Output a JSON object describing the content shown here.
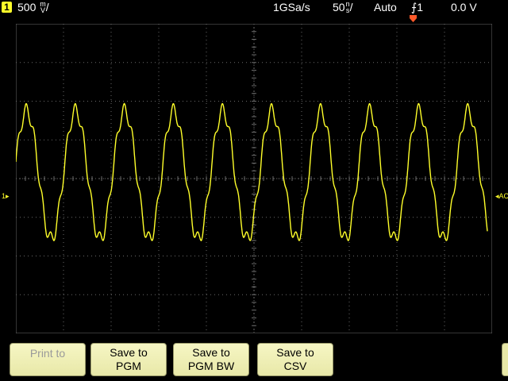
{
  "status": {
    "channel": "1",
    "vertical_scale": "500",
    "vertical_unit_top": "m",
    "vertical_unit_bottom": "V",
    "vertical_suffix": "/",
    "sample_rate": "1GSa/s",
    "timebase": "50",
    "timebase_unit_top": "n",
    "timebase_unit_bottom": "s",
    "timebase_suffix": "/",
    "trigger_mode": "Auto",
    "trigger_slope_icon": "rising-edge-icon",
    "trigger_slope_glyph": "⨍",
    "trigger_source": "1",
    "trigger_level": "0.0 V"
  },
  "markers": {
    "ground_marker": "1",
    "ac_marker": "AC"
  },
  "colors": {
    "trace": "#ffff2a",
    "grid": "#6a6a6a",
    "trigger": "#ff5a2a",
    "softkey": "#f0f0b8"
  },
  "softkeys": [
    {
      "line1": "Print to",
      "line2": "",
      "enabled": false
    },
    {
      "line1": "Save to",
      "line2": "PGM",
      "enabled": true
    },
    {
      "line1": "Save to",
      "line2": "PGM BW",
      "enabled": true
    },
    {
      "line1": "Save to",
      "line2": "CSV",
      "enabled": true
    }
  ],
  "chart_data": {
    "type": "line",
    "xlim": [
      -250,
      250
    ],
    "ylim": [
      -2000,
      2000
    ],
    "x_divisions": 10,
    "y_divisions": 8,
    "waveform": {
      "period_ns": 51.5,
      "start_ns": -250,
      "end_ns": 245,
      "peak_mv": 880,
      "trough_mv": -780,
      "ripple_mv": 90,
      "ripple_cycles_per_period": 6
    }
  }
}
